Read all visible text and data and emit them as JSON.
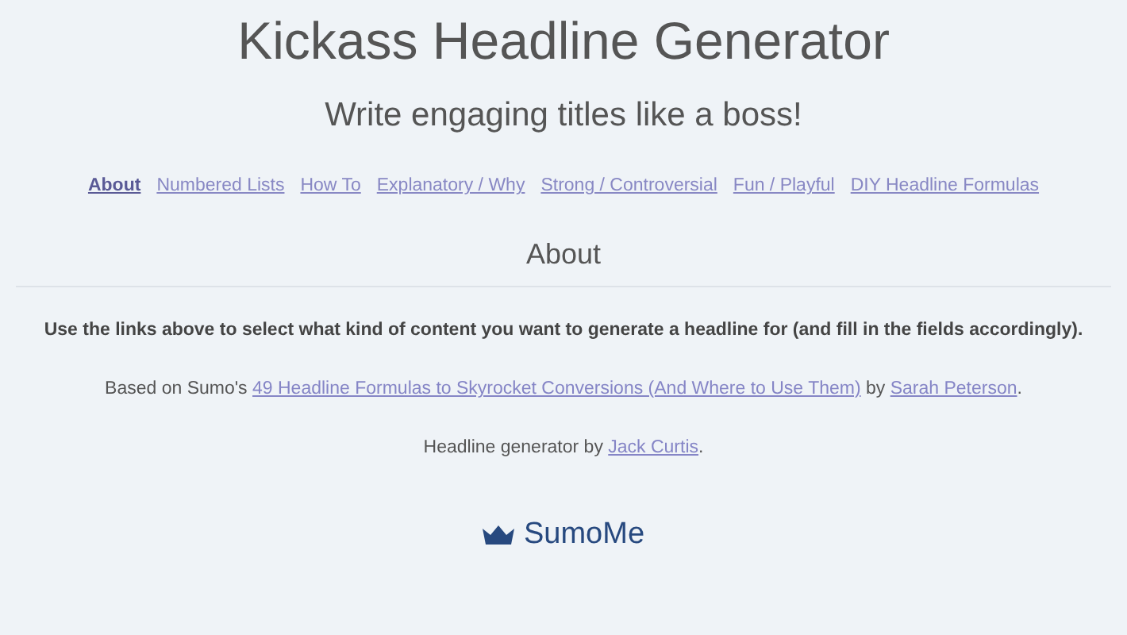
{
  "title": "Kickass Headline Generator",
  "subtitle": "Write engaging titles like a boss!",
  "nav": [
    {
      "label": "About",
      "selected": true
    },
    {
      "label": "Numbered Lists",
      "selected": false
    },
    {
      "label": "How To",
      "selected": false
    },
    {
      "label": "Explanatory / Why",
      "selected": false
    },
    {
      "label": "Strong / Controversial",
      "selected": false
    },
    {
      "label": "Fun / Playful",
      "selected": false
    },
    {
      "label": "DIY Headline Formulas",
      "selected": false
    }
  ],
  "section_heading": "About",
  "paragraphs": [
    {
      "kind": "bold",
      "parts": [
        {
          "kind": "text",
          "text": "Use the links above to select what kind of content you want to generate a headline for (and fill in the fields accordingly)."
        }
      ]
    },
    {
      "kind": "plain",
      "parts": [
        {
          "kind": "text",
          "text": "Based on Sumo's "
        },
        {
          "kind": "link",
          "text": "49 Headline Formulas to Skyrocket Conversions (And Where to Use Them)"
        },
        {
          "kind": "text",
          "text": " by "
        },
        {
          "kind": "link",
          "text": "Sarah Peterson"
        },
        {
          "kind": "text",
          "text": "."
        }
      ]
    },
    {
      "kind": "plain",
      "parts": [
        {
          "kind": "text",
          "text": "Headline generator by "
        },
        {
          "kind": "link",
          "text": "Jack Curtis"
        },
        {
          "kind": "text",
          "text": "."
        }
      ]
    }
  ],
  "brand": "SumoMe"
}
